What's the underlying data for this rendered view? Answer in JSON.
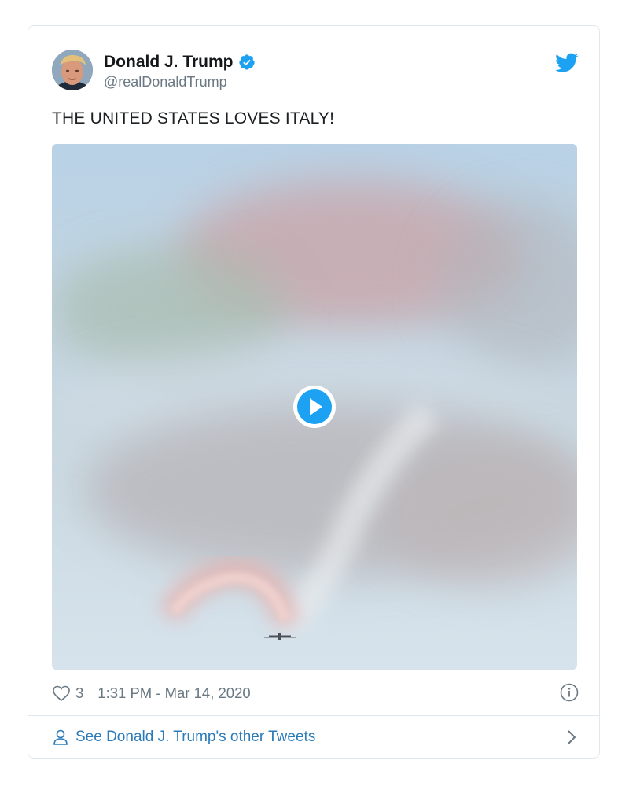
{
  "tweet": {
    "author": {
      "display_name": "Donald J. Trump",
      "handle": "@realDonaldTrump",
      "verified": true,
      "avatar_icon": "avatar-photo"
    },
    "text": "THE UNITED STATES LOVES ITALY!",
    "media": {
      "type": "video",
      "play_icon": "play-icon"
    },
    "likes": "3",
    "timestamp": "1:31 PM - Mar 14, 2020"
  },
  "footer": {
    "label": "See Donald J. Trump's other Tweets"
  },
  "colors": {
    "accent": "#1da1f2",
    "link": "#2b7bb9",
    "text": "#14171a",
    "muted": "#697882",
    "border": "#e1e8ed"
  }
}
